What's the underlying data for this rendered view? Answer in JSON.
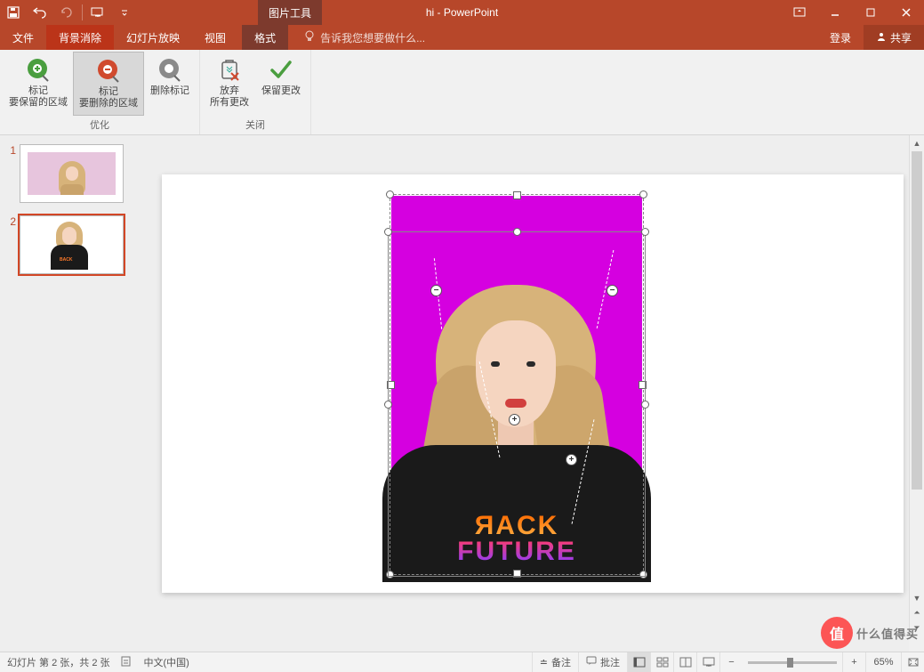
{
  "title": "hi - PowerPoint",
  "contextual_tab": "图片工具",
  "tabs": {
    "file": "文件",
    "bg_remove": "背景消除",
    "slideshow": "幻灯片放映",
    "view": "视图",
    "format": "格式"
  },
  "tell_me_placeholder": "告诉我您想要做什么...",
  "account": {
    "signin": "登录",
    "share": "共享"
  },
  "ribbon": {
    "refine": {
      "mark_keep": "标记\n要保留的区域",
      "mark_remove": "标记\n要删除的区域",
      "delete_mark": "删除标记",
      "group_label": "优化"
    },
    "close": {
      "discard": "放弃\n所有更改",
      "keep": "保留更改",
      "group_label": "关闭"
    }
  },
  "slides": {
    "n1": "1",
    "n2": "2"
  },
  "shirt": {
    "line1": "ЯACK",
    "line2": "FUTURE"
  },
  "status": {
    "slide_info": "幻灯片 第 2 张，共 2 张",
    "language": "中文(中国)",
    "notes": "备注",
    "comments": "批注",
    "zoom_pct": "65%"
  },
  "watermark": {
    "icon": "值",
    "text": "什么值得买"
  },
  "marks": {
    "minus": "−",
    "plus": "+"
  }
}
